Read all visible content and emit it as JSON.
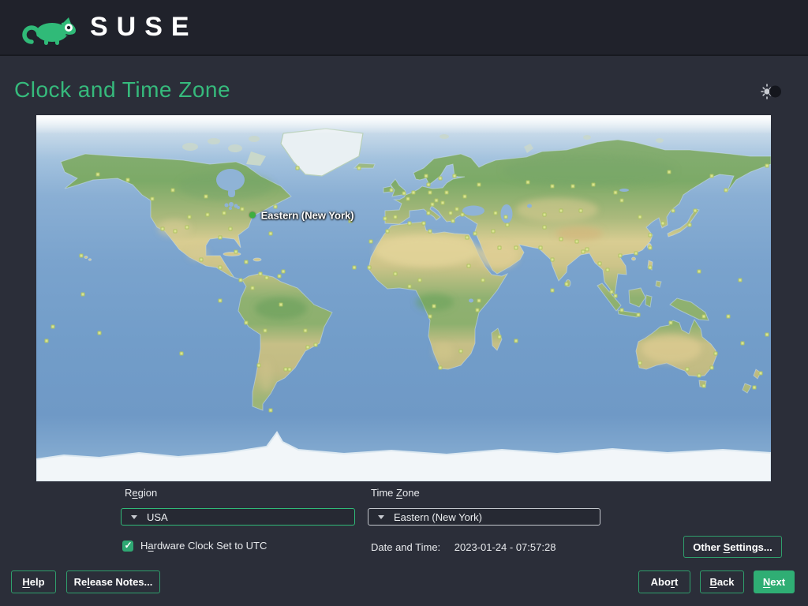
{
  "brand": {
    "name": "SUSE"
  },
  "header": {
    "title": "Clock and Time Zone"
  },
  "map": {
    "selected_marker": {
      "label": "Eastern (New York)",
      "lon": -74.2,
      "lat": 40.8,
      "dot_color": "#3fae3f"
    },
    "city_dots": [
      [
        -150,
        61
      ],
      [
        -135,
        58
      ],
      [
        -123,
        49
      ],
      [
        -118,
        34
      ],
      [
        -105,
        40
      ],
      [
        -112,
        33
      ],
      [
        -96,
        41
      ],
      [
        -88,
        42
      ],
      [
        -79,
        44
      ],
      [
        -63,
        45
      ],
      [
        -97,
        50
      ],
      [
        -113,
        53
      ],
      [
        -106,
        35
      ],
      [
        -90,
        30
      ],
      [
        -85,
        34
      ],
      [
        -99,
        19
      ],
      [
        -90,
        15
      ],
      [
        -82,
        23
      ],
      [
        -77,
        18
      ],
      [
        -80,
        9
      ],
      [
        -74,
        5
      ],
      [
        -77,
        -12
      ],
      [
        -71,
        -33
      ],
      [
        -58,
        -35
      ],
      [
        -47,
        -24
      ],
      [
        -43,
        -23
      ],
      [
        -48,
        -16
      ],
      [
        -60,
        -3
      ],
      [
        -67,
        10
      ],
      [
        -68,
        -16
      ],
      [
        -56,
        -35
      ],
      [
        -65,
        -55
      ],
      [
        -52,
        64
      ],
      [
        -22,
        64
      ],
      [
        -26,
        38
      ],
      [
        -158,
        21
      ],
      [
        -149,
        -17
      ],
      [
        -90,
        -1
      ],
      [
        -109,
        -27
      ],
      [
        -172,
        -14
      ],
      [
        0,
        51.5
      ],
      [
        -6,
        53
      ],
      [
        -9,
        39
      ],
      [
        -4,
        40
      ],
      [
        2,
        49
      ],
      [
        5,
        52
      ],
      [
        11,
        60
      ],
      [
        18,
        59
      ],
      [
        12,
        56
      ],
      [
        13,
        52
      ],
      [
        12,
        42
      ],
      [
        16,
        48
      ],
      [
        21,
        52
      ],
      [
        24,
        38
      ],
      [
        25,
        60
      ],
      [
        30,
        50
      ],
      [
        37,
        56
      ],
      [
        29,
        41
      ],
      [
        26,
        44
      ],
      [
        14,
        46
      ],
      [
        19,
        47
      ],
      [
        23,
        42
      ],
      [
        -8,
        33
      ],
      [
        3,
        37
      ],
      [
        10,
        37
      ],
      [
        31,
        30
      ],
      [
        13,
        33
      ],
      [
        3,
        6
      ],
      [
        -17,
        15
      ],
      [
        15,
        -4
      ],
      [
        37,
        -1
      ],
      [
        39,
        9
      ],
      [
        32,
        16
      ],
      [
        28,
        -26
      ],
      [
        18,
        -34
      ],
      [
        47,
        -19
      ],
      [
        13,
        -9
      ],
      [
        36,
        -6
      ],
      [
        -4,
        12
      ],
      [
        8,
        9
      ],
      [
        35,
        32
      ],
      [
        47,
        25
      ],
      [
        55,
        25
      ],
      [
        51,
        36
      ],
      [
        44,
        33
      ],
      [
        50,
        40
      ],
      [
        45,
        42
      ],
      [
        61,
        57
      ],
      [
        73,
        55
      ],
      [
        83,
        55
      ],
      [
        93,
        56
      ],
      [
        104,
        52
      ],
      [
        130,
        62
      ],
      [
        132,
        43
      ],
      [
        151,
        60
      ],
      [
        158,
        53
      ],
      [
        178,
        65
      ],
      [
        69,
        41
      ],
      [
        77,
        43
      ],
      [
        69,
        35
      ],
      [
        67,
        25
      ],
      [
        77,
        29
      ],
      [
        73,
        19
      ],
      [
        88,
        23
      ],
      [
        80,
        7
      ],
      [
        85,
        28
      ],
      [
        90,
        24
      ],
      [
        96,
        17
      ],
      [
        100,
        14
      ],
      [
        106,
        21
      ],
      [
        102,
        3
      ],
      [
        104,
        1
      ],
      [
        107,
        -6
      ],
      [
        115,
        -8
      ],
      [
        121,
        15
      ],
      [
        114,
        22
      ],
      [
        121,
        31
      ],
      [
        116,
        40
      ],
      [
        127,
        37
      ],
      [
        140,
        36
      ],
      [
        143,
        43
      ],
      [
        121,
        25
      ],
      [
        107,
        48
      ],
      [
        87,
        43
      ],
      [
        116,
        -32
      ],
      [
        131,
        -12
      ],
      [
        139,
        -35
      ],
      [
        151,
        -34
      ],
      [
        153,
        -27
      ],
      [
        145,
        -38
      ],
      [
        147,
        -43
      ],
      [
        175,
        -37
      ],
      [
        172,
        -44
      ],
      [
        178,
        -18
      ],
      [
        145,
        13
      ],
      [
        147,
        -9
      ],
      [
        166,
        -22
      ],
      [
        159,
        -9
      ],
      [
        -16,
        28
      ],
      [
        -24,
        15
      ],
      [
        -65,
        32
      ],
      [
        55,
        -21
      ],
      [
        73,
        4
      ],
      [
        -59,
        13
      ],
      [
        -61,
        11
      ],
      [
        -70,
        12
      ],
      [
        -175,
        -21
      ],
      [
        165,
        9
      ],
      [
        -157,
        2
      ]
    ]
  },
  "form": {
    "region": {
      "label": {
        "pre": "R",
        "mn": "e",
        "post": "gion"
      },
      "value": "USA"
    },
    "time_zone": {
      "label": {
        "pre": "Time ",
        "mn": "Z",
        "post": "one"
      },
      "value": "Eastern (New York)"
    },
    "hardware_clock": {
      "checked": true,
      "label": {
        "pre": "H",
        "mn": "a",
        "post": "rdware Clock Set to UTC"
      }
    },
    "date_time": {
      "label": "Date and Time:",
      "value": "2023-01-24 - 07:57:28"
    },
    "other_settings_button": {
      "pre": "Other ",
      "mn": "S",
      "post": "ettings..."
    }
  },
  "footer": {
    "help_button": {
      "pre": "",
      "mn": "H",
      "post": "elp"
    },
    "release_notes_button": {
      "pre": "Re",
      "mn": "l",
      "post": "ease Notes..."
    },
    "abort_button": {
      "pre": "Abo",
      "mn": "r",
      "post": "t"
    },
    "back_button": {
      "pre": "",
      "mn": "B",
      "post": "ack"
    },
    "next_button": {
      "pre": "",
      "mn": "N",
      "post": "ext"
    }
  },
  "colors": {
    "accent_green": "#30ba78",
    "header_bg": "#20222b",
    "body_bg": "#2b2e39",
    "ocean_blue": "#7ba3cd"
  }
}
